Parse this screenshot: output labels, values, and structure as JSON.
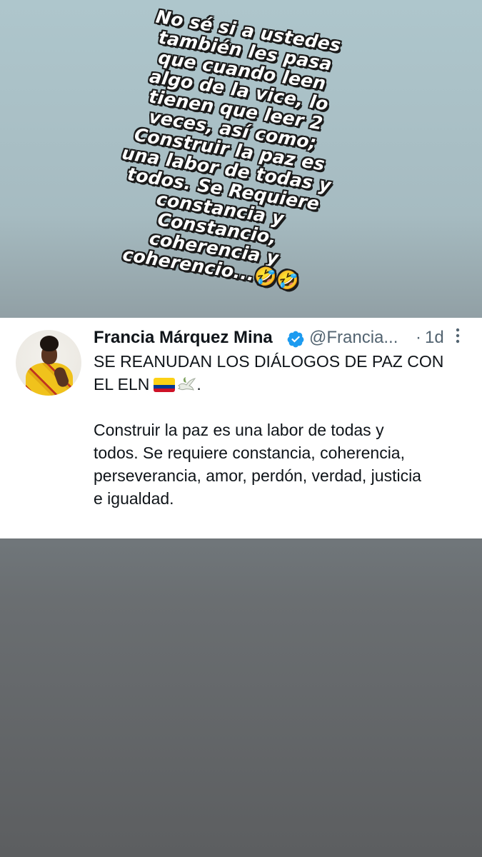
{
  "story": {
    "overlay_lines": [
      "No sé si a ustedes",
      "también les pasa",
      "que cuando leen",
      "algo de la vice, lo",
      "tienen que leer 2",
      "veces, así como;",
      "Construir la paz es",
      "una labor de todas y",
      "todos.  Se Requiere",
      "constancia y",
      "Constancio,",
      "coherencia y",
      "coherencio..."
    ],
    "overlay_emoji": "🤣🤣"
  },
  "tweet": {
    "display_name": "Francia Márquez Mina",
    "handle": "@Francia...",
    "time_separator": "·",
    "time": "1d",
    "body_line_1": "SE REANUDAN LOS DIÁLOGOS DE PAZ CON",
    "body_line_2": "EL ELN",
    "body_line_2_end": ".",
    "body_para_2": [
      "Construir la paz es una labor de todas y",
      "todos.  Se requiere constancia, coherencia,",
      "perseverancia, amor, perdón, verdad, justicia",
      "e igualdad."
    ],
    "icons": {
      "verified": "verified-badge-icon",
      "more": "more-vertical-icon",
      "flag": "colombia-flag-icon",
      "dove": "dove-icon"
    },
    "colors": {
      "verified_blue": "#1d9bf0",
      "flag_yellow": "#fcd116",
      "flag_blue": "#003893",
      "flag_red": "#ce1126"
    }
  }
}
